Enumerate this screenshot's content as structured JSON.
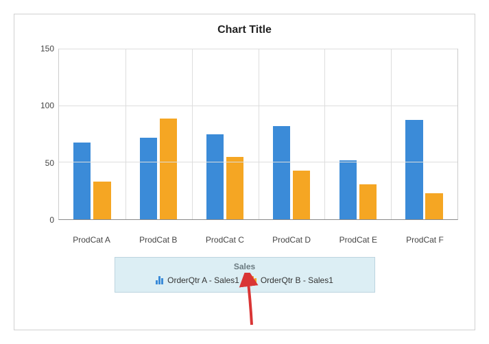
{
  "chart_data": {
    "type": "bar",
    "title": "Chart Title",
    "categories": [
      "ProdCat A",
      "ProdCat B",
      "ProdCat C",
      "ProdCat D",
      "ProdCat E",
      "ProdCat F"
    ],
    "series": [
      {
        "name": "OrderQtr A - Sales1",
        "color": "#3b8bd8",
        "values": [
          68,
          72,
          75,
          82,
          52,
          88
        ]
      },
      {
        "name": "OrderQtr B - Sales1",
        "color": "#f5a623",
        "values": [
          33,
          89,
          55,
          43,
          31,
          23
        ]
      }
    ],
    "y_ticks": [
      0,
      50,
      100,
      150
    ],
    "ylim": [
      0,
      150
    ],
    "legend": {
      "title": "Sales",
      "position": "bottom"
    },
    "annotation_arrow": true
  }
}
